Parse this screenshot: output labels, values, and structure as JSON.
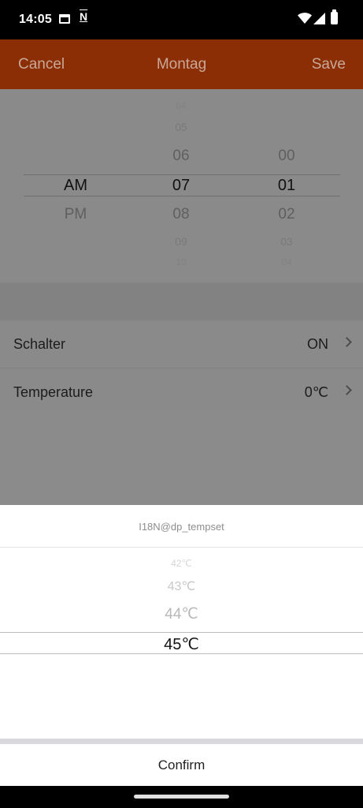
{
  "status_bar": {
    "time": "14:05",
    "notification_letter": "N"
  },
  "header": {
    "cancel_label": "Cancel",
    "title": "Montag",
    "save_label": "Save"
  },
  "time_picker": {
    "ampm": {
      "selected": "AM",
      "below": [
        "PM"
      ]
    },
    "hour": {
      "above": [
        "04",
        "05",
        "06"
      ],
      "selected": "07",
      "below": [
        "08",
        "09",
        "10"
      ]
    },
    "minute": {
      "above": [
        "00"
      ],
      "selected": "01",
      "below": [
        "02",
        "03",
        "04"
      ]
    }
  },
  "settings": [
    {
      "label": "Schalter",
      "value": "ON"
    },
    {
      "label": "Temperature",
      "value": "0℃"
    }
  ],
  "temp_sheet": {
    "title": "I18N@dp_tempset",
    "above": [
      "42℃",
      "43℃",
      "44℃"
    ],
    "selected": "45℃",
    "confirm_label": "Confirm"
  },
  "colors": {
    "header_bg": "#8b2e05",
    "overlay_gray": "#8b8b8b",
    "sheet_bg": "#ffffff"
  }
}
